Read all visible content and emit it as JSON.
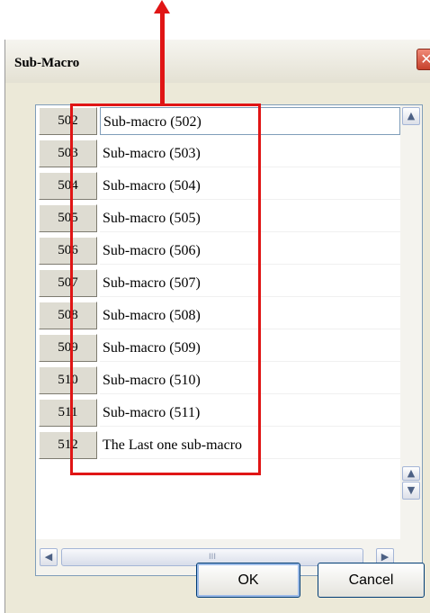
{
  "dialog": {
    "title": "Sub-Macro",
    "close_glyph": "✕"
  },
  "rows": [
    {
      "num": "502",
      "name": "Sub-macro (502)"
    },
    {
      "num": "503",
      "name": "Sub-macro (503)"
    },
    {
      "num": "504",
      "name": "Sub-macro (504)"
    },
    {
      "num": "505",
      "name": "Sub-macro (505)"
    },
    {
      "num": "506",
      "name": "Sub-macro (506)"
    },
    {
      "num": "507",
      "name": "Sub-macro (507)"
    },
    {
      "num": "508",
      "name": "Sub-macro (508)"
    },
    {
      "num": "509",
      "name": "Sub-macro (509)"
    },
    {
      "num": "510",
      "name": "Sub-macro (510)"
    },
    {
      "num": "511",
      "name": "Sub-macro (511)"
    },
    {
      "num": "512",
      "name": "The Last one sub-macro"
    }
  ],
  "scroll": {
    "up_glyph": "▲",
    "down_glyph": "▼",
    "left_glyph": "◀",
    "right_glyph": "▶",
    "thumb_grip": "III"
  },
  "buttons": {
    "ok_label": "OK",
    "cancel_label": "Cancel"
  },
  "annotation": {
    "color": "#e01515"
  }
}
